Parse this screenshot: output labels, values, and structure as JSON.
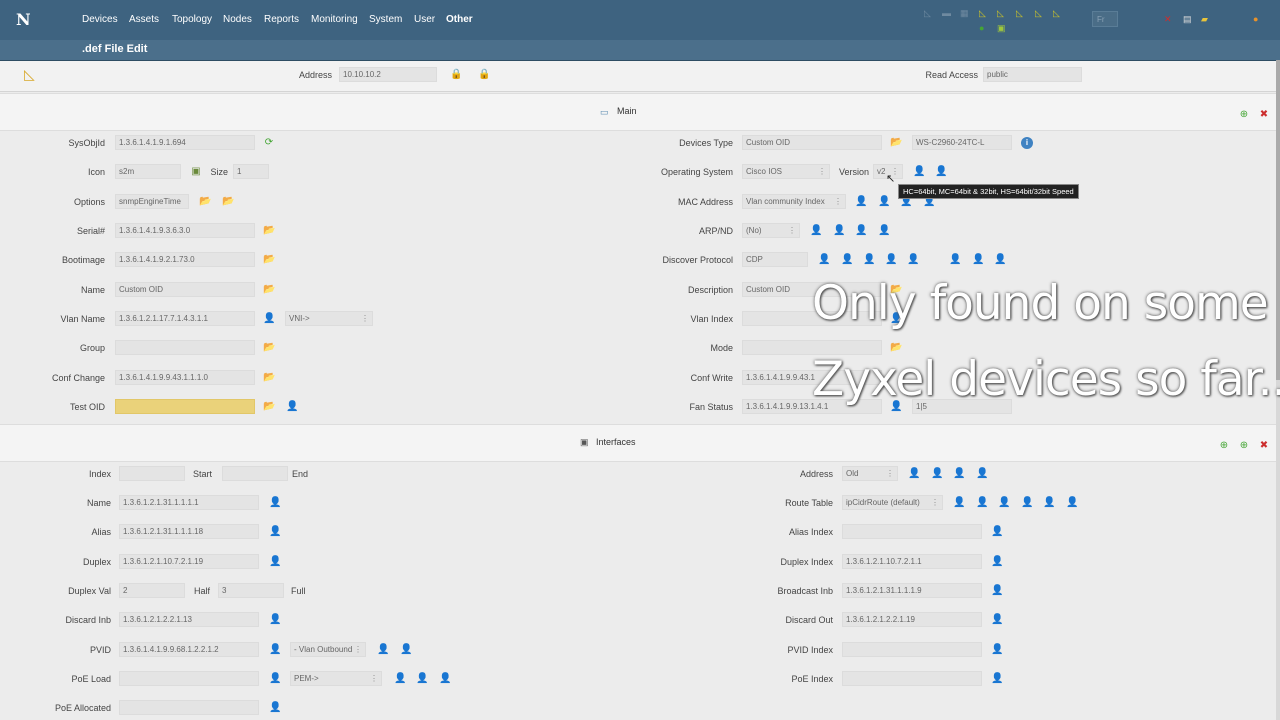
{
  "nav": {
    "logo": "N",
    "items": [
      "Devices",
      "Assets",
      "Topology",
      "Nodes",
      "Reports",
      "Monitoring",
      "System",
      "User",
      "Other"
    ],
    "search_placeholder": "Fr"
  },
  "page": {
    "subtitle": ".def File Edit"
  },
  "header": {
    "address_label": "Address",
    "address_value": "10.10.10.2",
    "read_access_label": "Read Access",
    "read_access_value": "public"
  },
  "main_section": {
    "title": "Main"
  },
  "main_left": {
    "sysobjid_label": "SysObjId",
    "sysobjid_value": "1.3.6.1.4.1.9.1.694",
    "icon_label": "Icon",
    "icon_value": "s2m",
    "size_label": "Size",
    "size_value": "1",
    "options_label": "Options",
    "options_value": "snmpEngineTime",
    "serial_label": "Serial#",
    "serial_value": "1.3.6.1.4.1.9.3.6.3.0",
    "bootimage_label": "Bootimage",
    "bootimage_value": "1.3.6.1.4.1.9.2.1.73.0",
    "name_label": "Name",
    "name_value": "Custom OID",
    "vlan_name_label": "Vlan Name",
    "vlan_name_value": "1.3.6.1.2.1.17.7.1.4.3.1.1",
    "vni_value": "VNI->",
    "group_label": "Group",
    "group_value": "",
    "conf_change_label": "Conf Change",
    "conf_change_value": "1.3.6.1.4.1.9.9.43.1.1.1.0",
    "test_oid_label": "Test OID",
    "test_oid_value": ""
  },
  "main_right": {
    "devices_type_label": "Devices Type",
    "devices_type_value": "Custom OID",
    "model_value": "WS-C2960-24TC-L",
    "os_label": "Operating System",
    "os_value": "Cisco IOS",
    "version_label": "Version",
    "version_value": "v2",
    "mac_label": "MAC Address",
    "mac_value": "Vlan community Index",
    "arp_label": "ARP/ND",
    "arp_value": "(No)",
    "discover_label": "Discover Protocol",
    "discover_value": "CDP",
    "description_label": "Description",
    "description_value": "Custom OID",
    "vlan_index_label": "Vlan Index",
    "vlan_index_value": "",
    "mode_label": "Mode",
    "mode_value": "",
    "conf_write_label": "Conf Write",
    "conf_write_value": "1.3.6.1.4.1.9.9.43.1",
    "fan_status_label": "Fan Status",
    "fan_status_value": "1.3.6.1.4.1.9.9.13.1.4.1",
    "fan_extra_value": "1|5"
  },
  "tooltip": "HC=64bit, MC=64bit & 32bit, HS=64bit/32bit Speed",
  "overlay": {
    "line1": "Only found on some",
    "line2": "Zyxel devices so far..."
  },
  "interfaces_section": {
    "title": "Interfaces"
  },
  "if_left": {
    "index_label": "Index",
    "index_value": "",
    "start_label": "Start",
    "start_value": "",
    "end_label": "End",
    "name_label": "Name",
    "name_value": "1.3.6.1.2.1.31.1.1.1.1",
    "alias_label": "Alias",
    "alias_value": "1.3.6.1.2.1.31.1.1.1.18",
    "duplex_label": "Duplex",
    "duplex_value": "1.3.6.1.2.1.10.7.2.1.19",
    "duplex_val_label": "Duplex Val",
    "duplex_val_value": "2",
    "half_label": "Half",
    "half_value": "3",
    "full_label": "Full",
    "discard_inb_label": "Discard Inb",
    "discard_inb_value": "1.3.6.1.2.1.2.2.1.13",
    "pvid_label": "PVID",
    "pvid_value": "1.3.6.1.4.1.9.9.68.1.2.2.1.2",
    "vlan_outbound_value": "- Vlan Outbound",
    "poe_load_label": "PoE Load",
    "poe_load_value": "",
    "pem_value": "PEM->",
    "poe_alloc_label": "PoE Allocated",
    "poe_alloc_value": ""
  },
  "if_right": {
    "address_label": "Address",
    "address_value": "Old",
    "route_label": "Route Table",
    "route_value": "ipCidrRoute (default)",
    "alias_index_label": "Alias Index",
    "alias_index_value": "",
    "duplex_index_label": "Duplex Index",
    "duplex_index_value": "1.3.6.1.2.1.10.7.2.1.1",
    "broadcast_label": "Broadcast Inb",
    "broadcast_value": "1.3.6.1.2.1.31.1.1.1.9",
    "discard_out_label": "Discard Out",
    "discard_out_value": "1.3.6.1.2.1.2.2.1.19",
    "pvid_index_label": "PVID Index",
    "pvid_index_value": "",
    "poe_index_label": "PoE Index",
    "poe_index_value": ""
  }
}
